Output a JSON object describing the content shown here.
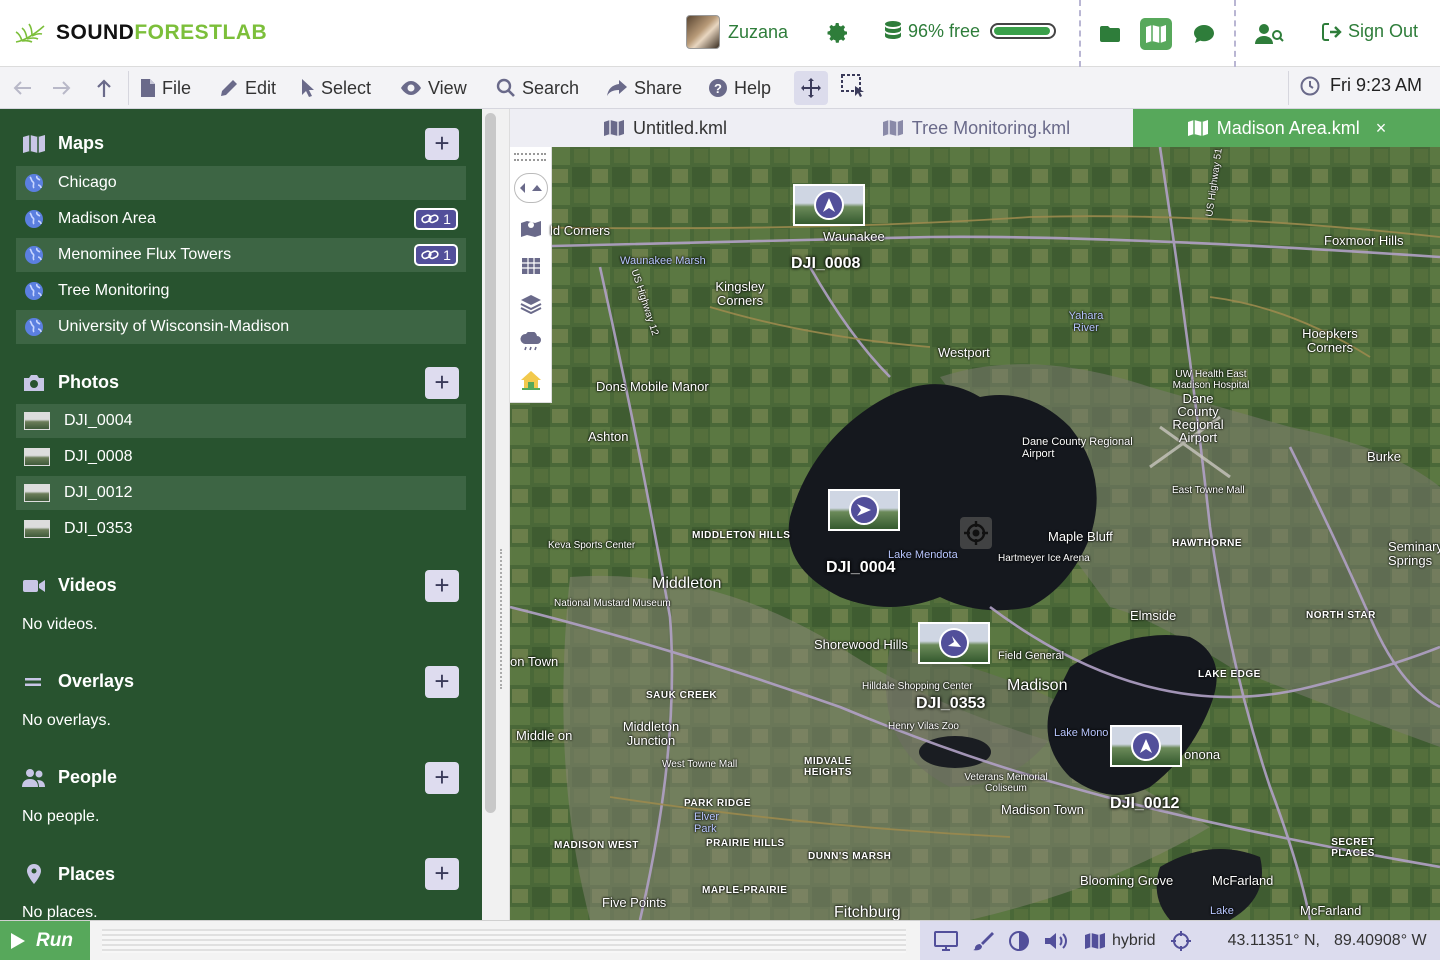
{
  "brand": {
    "part1": "SOUND",
    "part2": "FORESTLAB"
  },
  "user": {
    "name": "Zuzana"
  },
  "storage": {
    "label": "96% free",
    "fraction_used": 0.96
  },
  "header": {
    "sign_out": "Sign Out"
  },
  "toolbar": {
    "file": "File",
    "edit": "Edit",
    "select": "Select",
    "view": "View",
    "search": "Search",
    "share": "Share",
    "help": "Help",
    "clock": "Fri 9:23 AM"
  },
  "sidebar": {
    "maps": {
      "title": "Maps",
      "items": [
        {
          "label": "Chicago"
        },
        {
          "label": "Madison Area",
          "badge": "1"
        },
        {
          "label": "Menominee Flux Towers",
          "badge": "1"
        },
        {
          "label": "Tree Monitoring"
        },
        {
          "label": "University of Wisconsin-Madison"
        }
      ]
    },
    "photos": {
      "title": "Photos",
      "items": [
        {
          "label": "DJI_0004"
        },
        {
          "label": "DJI_0008"
        },
        {
          "label": "DJI_0012"
        },
        {
          "label": "DJI_0353"
        }
      ]
    },
    "videos": {
      "title": "Videos",
      "empty": "No videos."
    },
    "overlays": {
      "title": "Overlays",
      "empty": "No overlays."
    },
    "people": {
      "title": "People",
      "empty": "No people."
    },
    "places": {
      "title": "Places",
      "empty": "No places."
    }
  },
  "tabs": [
    {
      "label": "Untitled.kml"
    },
    {
      "label": "Tree Monitoring.kml"
    },
    {
      "label": "Madison Area.kml",
      "close": "×"
    }
  ],
  "map": {
    "labels": {
      "corners": "ld Corners",
      "waunakee": "Waunakee",
      "foxmoor": "Foxmoor Hills",
      "waunakee_marsh": "Waunakee Marsh",
      "kingsley": "Kingsley Corners",
      "yahara": "Yahara River",
      "hoepkers": "Hoepkers Corners",
      "westport": "Westport",
      "dons": "Dons Mobile Manor",
      "uw_health": "UW Health East Madison Hospital",
      "dane_airport": "Dane County Regional Airport",
      "dane_airport2": "Dane County Regional Airport",
      "ashton": "Ashton",
      "burke": "Burke",
      "east_towne": "East Towne Mall",
      "keva": "Keva Sports Center",
      "middleton_hills": "MIDDLETON HILLS",
      "maple_bluff": "Maple Bluff",
      "hawthorne": "HAWTHORNE",
      "seminary": "Seminary Springs",
      "hartmeyer": "Hartmeyer Ice Arena",
      "lake_mendota": "Lake Mendota",
      "middleton": "Middleton",
      "mustard": "National Mustard Museum",
      "elmside": "Elmside",
      "north_star": "NORTH STAR",
      "shorewood": "Shorewood Hills",
      "field_general": "Field General",
      "on_town": "on Town",
      "madison": "Madison",
      "lake_edge": "LAKE EDGE",
      "hilldale": "Hilldale Shopping Center",
      "sauk_creek": "SAUK CREEK",
      "middleton_junction": "Middleton Junction",
      "henry_vilas": "Henry Vilas Zoo",
      "lake_monona": "Lake Mono",
      "monona": "onona",
      "middleton2": "Middle on",
      "west_towne": "West Towne Mall",
      "midvale": "MIDVALE HEIGHTS",
      "veterans": "Veterans Memorial Coliseum",
      "madison_town": "Madison Town",
      "park_ridge": "PARK RIDGE",
      "elver": "Elver Park",
      "madison_west": "MADISON WEST",
      "prairie_hills": "PRAIRIE HILLS",
      "secret_places": "SECRET PLACES",
      "dunns": "DUNN'S MARSH",
      "blooming": "Blooming Grove",
      "mcfarland": "McFarland",
      "maple_prairie": "MAPLE-PRAIRIE",
      "five_points": "Five Points",
      "fitchburg": "Fitchburg",
      "lake": "Lake",
      "mcfarland2": "McFarland",
      "us_highway": "US Highway 12",
      "us_highway2": "US Highway 51"
    },
    "photos": [
      {
        "name": "DJI_0008"
      },
      {
        "name": "DJI_0004"
      },
      {
        "name": "DJI_0353"
      },
      {
        "name": "DJI_0012"
      }
    ]
  },
  "bottombar": {
    "run": "Run",
    "basemap": "hybrid",
    "lat": "43.11351° N,",
    "lon": "89.40908° W"
  },
  "colors": {
    "brand_green": "#7cbf3a",
    "accent_green": "#57a85b",
    "sidebar_bg": "#28532f",
    "purple": "#524f9a"
  }
}
